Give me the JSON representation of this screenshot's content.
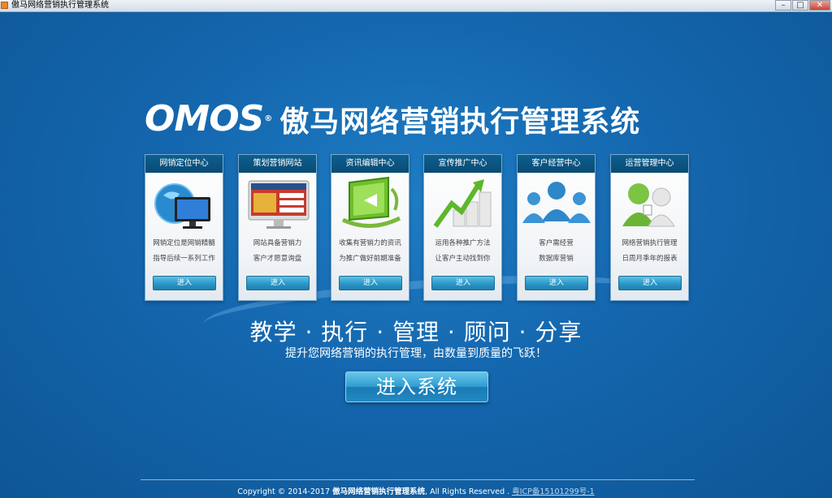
{
  "window": {
    "title": "傲马网络营销执行管理系统",
    "minimize_glyph": "–",
    "maximize_glyph": "□",
    "close_glyph": "✕"
  },
  "header": {
    "logo_text": "OMOS",
    "logo_mark": "®",
    "app_title": "傲马网络营销执行管理系统"
  },
  "cards": [
    {
      "title": "网销定位中心",
      "line1": "网销定位是网销精髓",
      "line2": "指导后续一系列工作",
      "button": "进入",
      "icon": "globe-monitor-icon"
    },
    {
      "title": "策划营销网站",
      "line1": "网站具备营销力",
      "line2": "客户才愿意询盘",
      "button": "进入",
      "icon": "website-monitor-icon"
    },
    {
      "title": "资讯编辑中心",
      "line1": "收集有营销力的资讯",
      "line2": "为推广做好前期准备",
      "button": "进入",
      "icon": "green-screen-icon"
    },
    {
      "title": "宣传推广中心",
      "line1": "运用各种推广方法",
      "line2": "让客户主动找到你",
      "button": "进入",
      "icon": "growth-chart-icon"
    },
    {
      "title": "客户经营中心",
      "line1": "客户需经营",
      "line2": "数据库营销",
      "button": "进入",
      "icon": "customers-icon"
    },
    {
      "title": "运营管理中心",
      "line1": "网络营销执行管理",
      "line2": "日周月季年的报表",
      "button": "进入",
      "icon": "manager-icon"
    }
  ],
  "slogan": "教学 · 执行 · 管理 · 顾问 · 分享",
  "subslogan": "提升您网络营销的执行管理，由数量到质量的飞跃！",
  "enter_button": "进入系统",
  "footer": {
    "copyright": "Copyright © 2014-2017 ",
    "company": "傲马网络营销执行管理系统",
    "rights": ", All Rights Reserved . ",
    "icp": "粤ICP备15101299号-1"
  },
  "colors": {
    "background": "#1466ad",
    "card_header": "#0c5f8f",
    "button": "#2b97c8"
  }
}
